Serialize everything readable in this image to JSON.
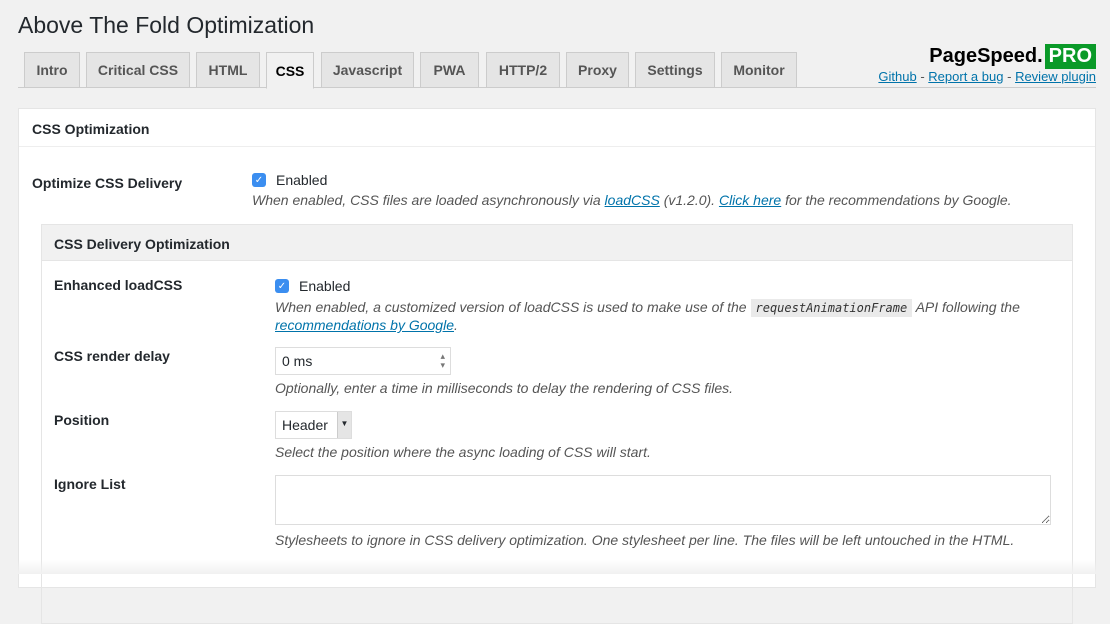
{
  "page_title": "Above The Fold Optimization",
  "tabs": [
    "Intro",
    "Critical CSS",
    "HTML",
    "CSS",
    "Javascript",
    "PWA",
    "HTTP/2",
    "Proxy",
    "Settings",
    "Monitor"
  ],
  "active_tab": "CSS",
  "brand": {
    "name": "PageSpeed.",
    "badge": "PRO",
    "badge_color": "#0a9a28"
  },
  "links": {
    "github": "Github",
    "sep": "-",
    "bug": "Report a bug",
    "review": "Review plugin"
  },
  "section": {
    "title": "CSS Optimization",
    "optimize": {
      "label": "Optimize CSS Delivery",
      "checkbox": "Enabled",
      "checked": true,
      "desc_1": "When enabled, CSS files are loaded asynchronously via ",
      "link1": "loadCSS",
      "desc_2": " (v1.2.0). ",
      "link2": "Click here",
      "desc_3": " for the recommendations by Google."
    }
  },
  "delivery": {
    "title": "CSS Delivery Optimization",
    "enhanced": {
      "label": "Enhanced loadCSS",
      "checkbox": "Enabled",
      "checked": true,
      "desc_1": "When enabled, a customized version of loadCSS is used to make use of the ",
      "code": "requestAnimationFrame",
      "desc_2": " API following the ",
      "link": "recommendations by Google",
      "desc_3": "."
    },
    "delay": {
      "label": "CSS render delay",
      "value": "0 ms",
      "desc": "Optionally, enter a time in milliseconds to delay the rendering of CSS files."
    },
    "position": {
      "label": "Position",
      "value": "Header",
      "desc": "Select the position where the async loading of CSS will start."
    },
    "ignore": {
      "label": "Ignore List",
      "value": "",
      "desc": "Stylesheets to ignore in CSS delivery optimization. One stylesheet per line. The files will be left untouched in the HTML."
    }
  }
}
